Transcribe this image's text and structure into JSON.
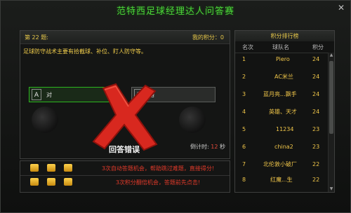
{
  "window": {
    "title": "范特西足球经理达人问答赛",
    "close_label": "✕"
  },
  "question": {
    "number_label": "第 22 题:",
    "score_label": "我的积分：0",
    "text": "足球防守战术主要有拾截球、补位、盯人防守等。",
    "options": [
      {
        "letter": "A",
        "text": "对"
      },
      {
        "letter": "B",
        "text": "错"
      }
    ],
    "result_label": "回答错误",
    "timer_label": "倒计时:",
    "timer_value": "12",
    "timer_unit": "秒"
  },
  "bonus": {
    "row1_text": "3次自动答题机会，帮助跳过难题，直接得分!",
    "row2_text": "3次积分翻倍机会，答题前先点击!"
  },
  "ranking": {
    "title": "积分排行榜",
    "headers": {
      "rank": "名次",
      "team": "球队名",
      "score": "积分"
    },
    "rows": [
      {
        "rank": "1",
        "team": "Piero",
        "score": "24"
      },
      {
        "rank": "2",
        "team": "AC米兰",
        "score": "24"
      },
      {
        "rank": "3",
        "team": "蓝月亮...飘手",
        "score": "24"
      },
      {
        "rank": "4",
        "team": "英雄、天才",
        "score": "24"
      },
      {
        "rank": "5",
        "team": "11234",
        "score": "23"
      },
      {
        "rank": "6",
        "team": "china2",
        "score": "23"
      },
      {
        "rank": "7",
        "team": "北伦敦小破厂",
        "score": "22"
      },
      {
        "rank": "8",
        "team": "红魔...生",
        "score": "22"
      }
    ]
  },
  "colors": {
    "accent_green": "#4bd33a",
    "gold": "#f0c649",
    "red": "#e23a2a"
  }
}
